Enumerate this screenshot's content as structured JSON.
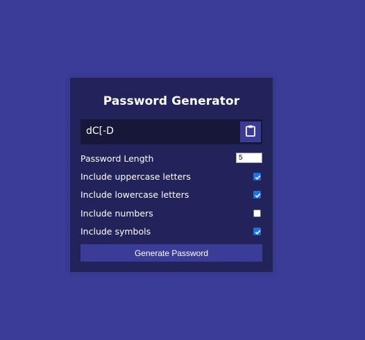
{
  "title": "Password Generator",
  "result": {
    "password": "dC[-D",
    "copy_icon": "clipboard-icon"
  },
  "settings": {
    "length": {
      "label": "Password Length",
      "value": "5"
    },
    "uppercase": {
      "label": "Include uppercase letters",
      "checked": true
    },
    "lowercase": {
      "label": "Include lowercase letters",
      "checked": true
    },
    "numbers": {
      "label": "Include numbers",
      "checked": false
    },
    "symbols": {
      "label": "Include symbols",
      "checked": true
    }
  },
  "generate_label": "Generate Password",
  "colors": {
    "page_bg": "#3b3b98",
    "card_bg": "#23235b",
    "result_bg": "#17173a",
    "accent": "#3b3b98",
    "checkbox": "#1a73e8"
  }
}
